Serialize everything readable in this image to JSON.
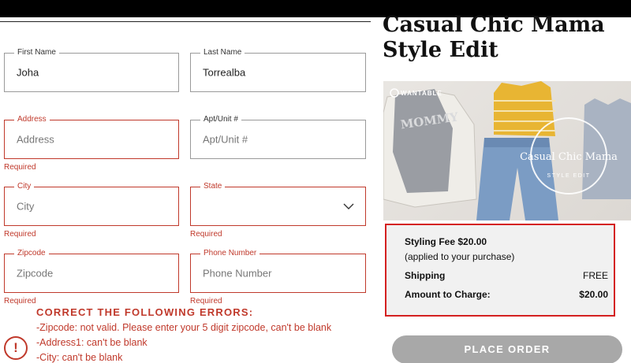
{
  "form": {
    "first_name": {
      "label": "First Name",
      "value": "Joha"
    },
    "last_name": {
      "label": "Last Name",
      "value": "Torrealba"
    },
    "address": {
      "label": "Address",
      "placeholder": "Address",
      "error": "Required"
    },
    "apt_unit": {
      "label": "Apt/Unit #",
      "placeholder": "Apt/Unit #"
    },
    "city": {
      "label": "City",
      "placeholder": "City",
      "error": "Required"
    },
    "state": {
      "label": "State",
      "value": "",
      "error": "Required"
    },
    "zipcode": {
      "label": "Zipcode",
      "placeholder": "Zipcode",
      "error": "Required"
    },
    "phone": {
      "label": "Phone Number",
      "placeholder": "Phone Number",
      "error": "Required"
    }
  },
  "errors": {
    "title": "CORRECT THE FOLLOWING ERRORS:",
    "icon_glyph": "!",
    "lines": [
      "-Zipcode: not valid. Please enter your 5 digit zipcode, can't be blank",
      "-Address1: can't be blank",
      "-City: can't be blank"
    ]
  },
  "product": {
    "title_line1": "Casual Chic Mama",
    "title_line2": "Style Edit",
    "image": {
      "brand": "WANTABLE",
      "stamp_text": "Casual Chic Mama",
      "stamp_sub": "STYLE EDIT",
      "shirt_text": "MOMMY"
    }
  },
  "summary": {
    "styling_fee": "Styling Fee $20.00",
    "styling_note": "(applied to your purchase)",
    "shipping_label": "Shipping",
    "shipping_value": "FREE",
    "charge_label": "Amount to Charge:",
    "charge_value": "$20.00",
    "highlight_color": "#d42020"
  },
  "actions": {
    "place_order": "PLACE ORDER"
  },
  "colors": {
    "error": "#c0392b",
    "button": "#a8a8a8",
    "summary_bg": "#f1f1f1"
  }
}
